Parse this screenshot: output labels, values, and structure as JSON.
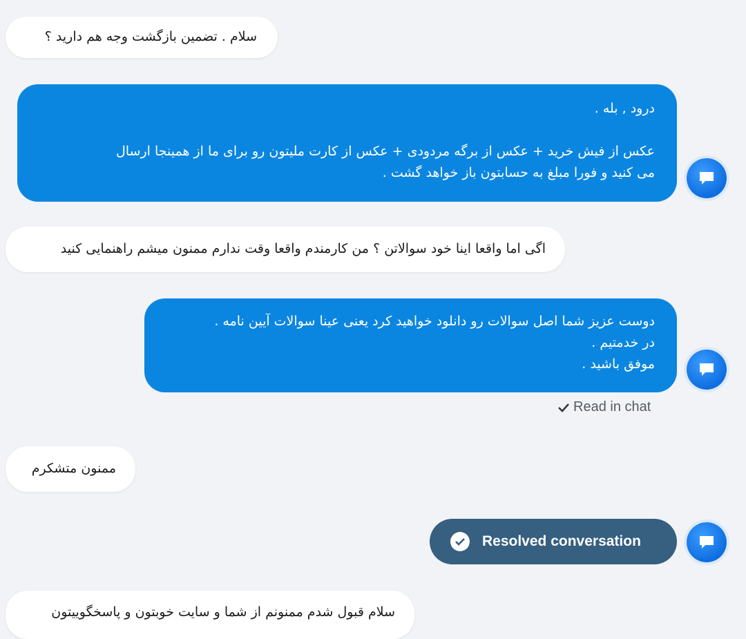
{
  "messages": [
    {
      "sender": "user",
      "text": "سلام . تضمین بازگشت وجه هم دارید ؟"
    },
    {
      "sender": "agent",
      "text": "درود , بله .\n\nعکس از فیش خرید + عکس از برگه مردودی + عکس از کارت ملیتون رو برای ما از همینجا ارسال\nمی کنید و فورا مبلغ به حسابتون باز خواهد گشت ."
    },
    {
      "sender": "user",
      "text": "اگی اما واقعا اینا خود سوالاتن ؟ من کارمندم واقعا وقت ندارم ممنون میشم راهنمایی کنید"
    },
    {
      "sender": "agent",
      "text": "دوست عزیز شما اصل سوالات رو دانلود خواهید کرد یعنی عینا سوالات آیین نامه .\nدر خدمتیم .\nموفق باشید ."
    },
    {
      "sender": "user",
      "text": "ممنون متشکرم"
    },
    {
      "sender": "user",
      "text": "سلام قبول شدم ممنونم از شما و سایت خوبتون و پاسخگوییتون"
    }
  ],
  "read_status": "Read in chat",
  "resolved_label": "Resolved conversation",
  "icons": {
    "avatar": "chat-bubble-icon",
    "read": "checkmark-icon",
    "resolved": "check-circle-icon"
  },
  "colors": {
    "background": "#f1f3f6",
    "user_bubble": "#ffffff",
    "agent_bubble": "#0b86e0",
    "resolved_pill": "#365f80",
    "avatar": "#1a7ef0"
  }
}
